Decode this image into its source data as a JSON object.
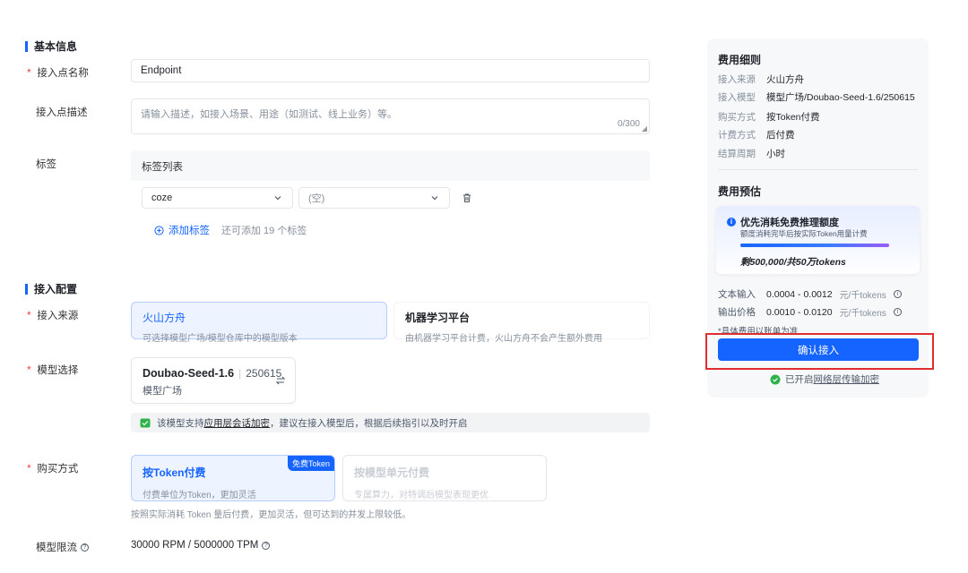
{
  "basic": {
    "section_title": "基本信息",
    "required_mark": "*",
    "name_label": "接入点名称",
    "name_value": "Endpoint",
    "desc_label": "接入点描述",
    "desc_placeholder": "请输入描述，如接入场景、用途（如测试、线上业务）等。",
    "desc_counter": "0/300",
    "tags_label": "标签",
    "tags_list_title": "标签列表",
    "tag_key": "coze",
    "tag_value_placeholder": "(空)",
    "add_tag_label": "添加标签",
    "add_tag_hint": "还可添加 19 个标签"
  },
  "config": {
    "section_title": "接入配置",
    "source_label": "接入来源",
    "sources": [
      {
        "title": "火山方舟",
        "desc": "可选择模型广场/模型仓库中的模型版本"
      },
      {
        "title": "机器学习平台",
        "desc": "由机器学习平台计费，火山方舟不会产生额外费用"
      }
    ],
    "model_label": "模型选择",
    "model_name": "Doubao-Seed-1.6",
    "model_sep": "|",
    "model_version": "250615",
    "model_source": "模型广场",
    "notice_pre": "该模型支持",
    "notice_link": "应用层会话加密",
    "notice_post": "，建议在接入模型后，根据后续指引以及时开启",
    "purchase_label": "购买方式",
    "purchase_options": [
      {
        "title": "按Token付费",
        "desc": "付费单位为Token，更加灵活",
        "badge": "免费Token"
      },
      {
        "title": "按模型单元付费",
        "desc": "专属算力，对特调后模型表现更优"
      }
    ],
    "purchase_note": "按照实际消耗 Token 量后付费，更加灵活，但可达到的并发上限较低。",
    "ratelimit_label": "模型限流",
    "ratelimit_value": "30000 RPM / 5000000 TPM"
  },
  "summary": {
    "fees_title": "费用细则",
    "rows": [
      {
        "k": "接入来源",
        "v": "火山方舟"
      },
      {
        "k": "接入模型",
        "v": "模型广场/Doubao-Seed-1.6/250615"
      },
      {
        "k": "购买方式",
        "v": "按Token付费"
      },
      {
        "k": "计费方式",
        "v": "后付费"
      },
      {
        "k": "结算周期",
        "v": "小时"
      }
    ],
    "estimate_title": "费用预估",
    "promo_title": "优先消耗免费推理额度",
    "promo_sub": "额度消耗完毕后按实际Token用量计费",
    "promo_foot": "剩500,000/共50万tokens",
    "promo_progress": 1.0,
    "price_rows": [
      {
        "k": "文本输入",
        "v": "0.0004 - 0.0012",
        "u": "元/千tokens"
      },
      {
        "k": "输出价格",
        "v": "0.0010 - 0.0120",
        "u": "元/千tokens"
      }
    ],
    "price_note": "*具体费用以账单为准",
    "confirm_label": "确认接入",
    "enc_pre": "已开启",
    "enc_link": "网络层传输加密"
  },
  "colors": {
    "accent": "#1664ff",
    "highlight": "#e02d2d",
    "required": "#f53f3f"
  }
}
